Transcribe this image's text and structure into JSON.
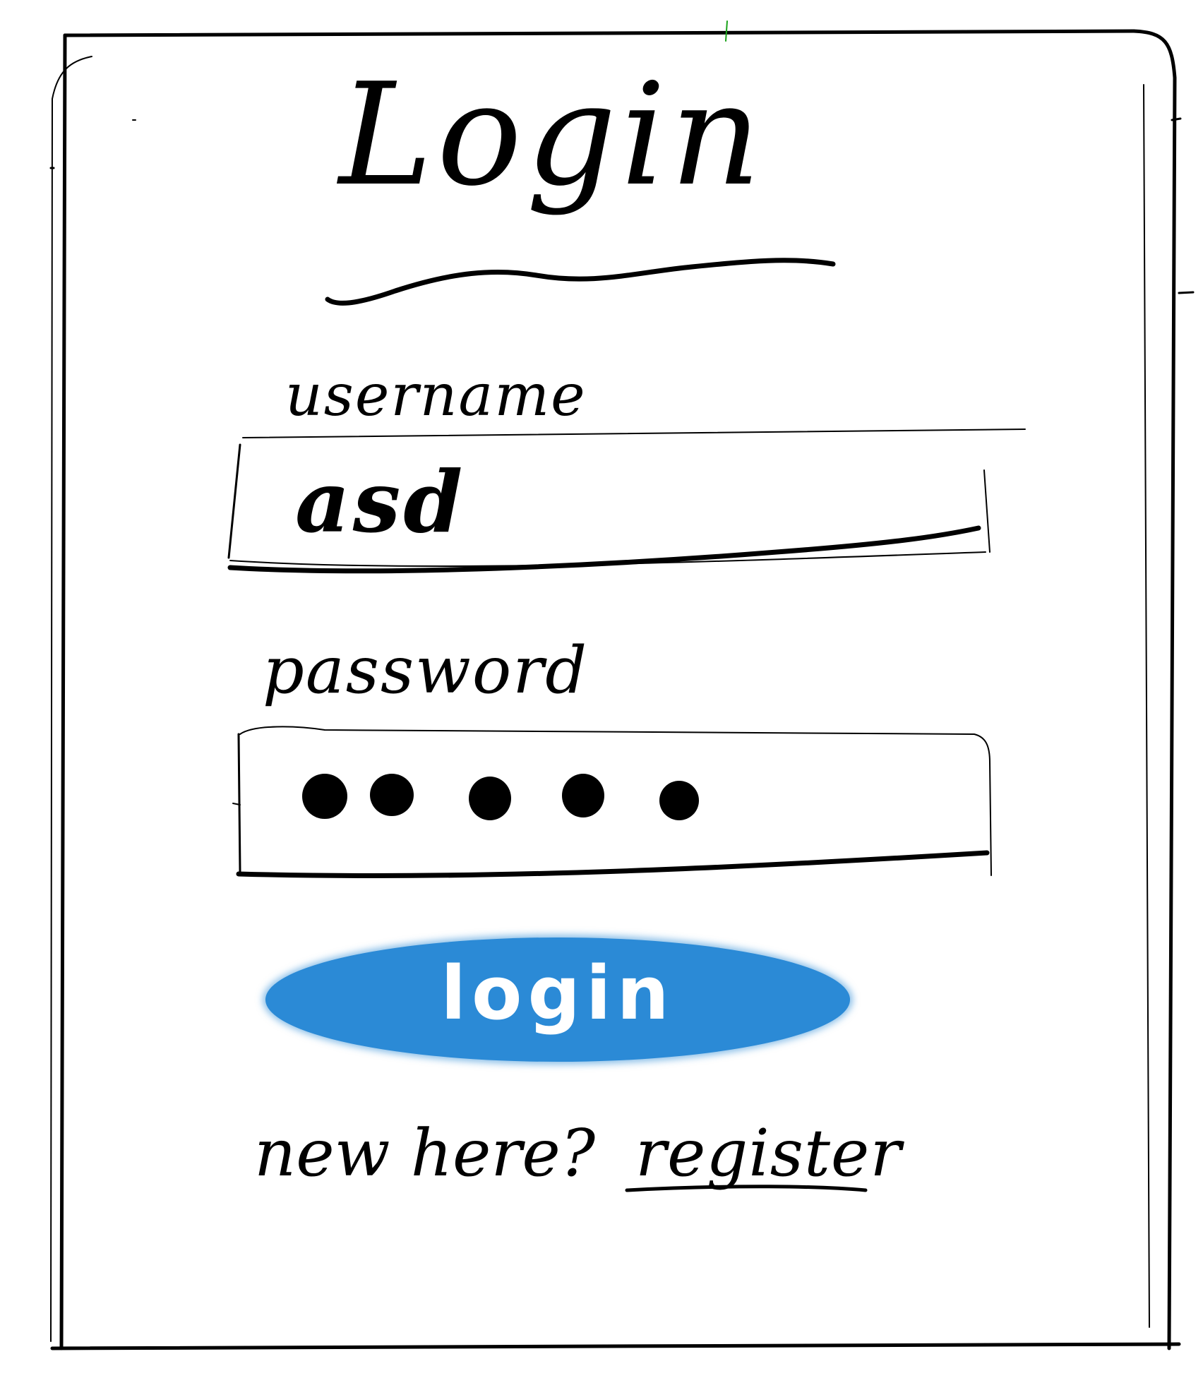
{
  "login_form": {
    "title": "Login",
    "username": {
      "label": "username",
      "value": "asd"
    },
    "password": {
      "label": "password",
      "masked_length": 5
    },
    "submit": {
      "label": "login",
      "color": "#2b8ad6"
    },
    "register": {
      "prompt": "new here?",
      "link_label": "register"
    }
  }
}
